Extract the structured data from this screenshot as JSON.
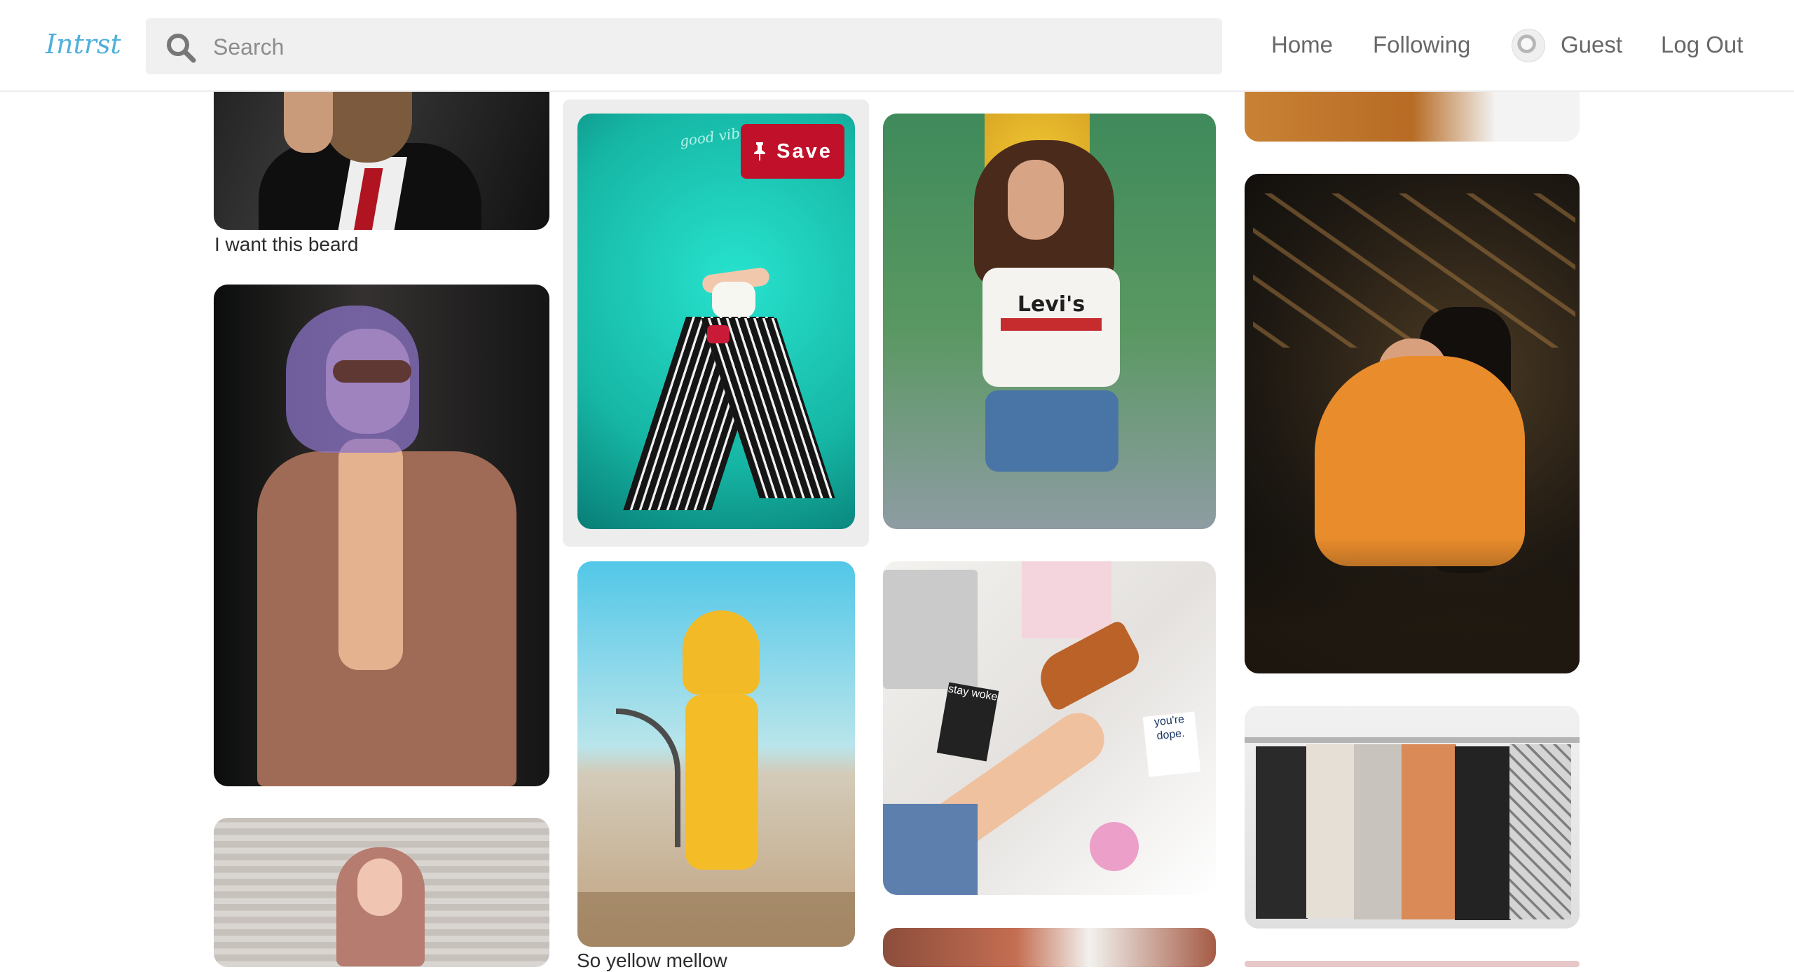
{
  "app": {
    "logo_text": "Intrst"
  },
  "search": {
    "placeholder": "Search"
  },
  "nav": {
    "home": "Home",
    "following": "Following",
    "user_name": "Guest",
    "logout": "Log Out"
  },
  "pins": {
    "beard_caption": "I want this beard",
    "yellow_caption": "So yellow mellow",
    "save_label": "Save"
  },
  "photo_text": {
    "levis": "Levi's",
    "neon": "good vibes",
    "tag_one": "you're dope.",
    "tag_two": "stay woke"
  },
  "colors": {
    "logo": "#4fb0da",
    "save": "#c1102a",
    "teal": "#1cc9b5",
    "yellow": "#f2ba27",
    "orange": "#e98c2c"
  },
  "icons": {
    "search": "search-icon",
    "pin": "pushpin-icon",
    "avatar": "guest-avatar"
  }
}
